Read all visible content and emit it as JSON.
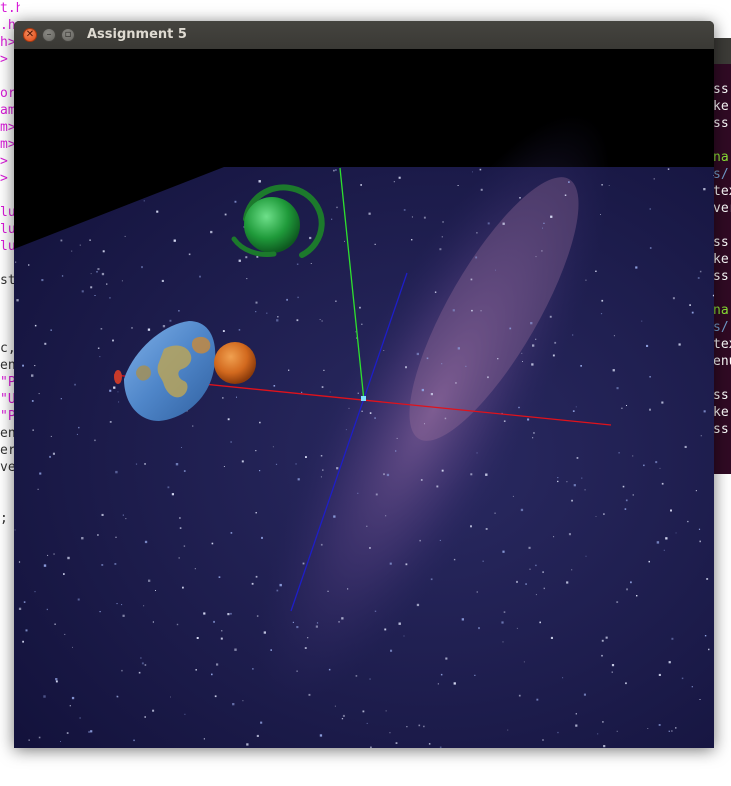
{
  "window": {
    "title": "Assignment 5"
  },
  "background_editor": {
    "lines": [
      {
        "text": "t.h>",
        "color": "#d81bd8"
      },
      {
        "text": ".h",
        "color": "#d81bd8"
      },
      {
        "text": "h>",
        "color": "#d81bd8"
      },
      {
        "text": ">",
        "color": "#d81bd8"
      },
      {
        "text": "",
        "color": "#333333"
      },
      {
        "text": "or",
        "color": "#d81bd8"
      },
      {
        "text": "am",
        "color": "#d81bd8"
      },
      {
        "text": "m>",
        "color": "#d81bd8"
      },
      {
        "text": "m>",
        "color": "#d81bd8"
      },
      {
        "text": ">",
        "color": "#d81bd8"
      },
      {
        "text": ">",
        "color": "#d81bd8"
      },
      {
        "text": "",
        "color": "#333333"
      },
      {
        "text": "lu",
        "color": "#d81bd8"
      },
      {
        "text": "lu",
        "color": "#d81bd8"
      },
      {
        "text": "lu",
        "color": "#d81bd8"
      },
      {
        "text": "",
        "color": "#333333"
      },
      {
        "text": "st",
        "color": "#333333"
      },
      {
        "text": "",
        "color": "#333333"
      },
      {
        "text": "",
        "color": "#333333"
      },
      {
        "text": "",
        "color": "#333333"
      },
      {
        "text": "c,",
        "color": "#333333"
      },
      {
        "text": "en",
        "color": "#333333"
      },
      {
        "text": "\"P",
        "color": "#d81bd8"
      },
      {
        "text": "\"U",
        "color": "#d81bd8"
      },
      {
        "text": "\"P",
        "color": "#d81bd8"
      },
      {
        "text": "en",
        "color": "#333333"
      },
      {
        "text": "er",
        "color": "#333333"
      },
      {
        "text": "ve",
        "color": "#333333"
      },
      {
        "text": "",
        "color": "#333333"
      },
      {
        "text": "",
        "color": "#333333"
      },
      {
        "text": ";",
        "color": "#333333"
      }
    ]
  },
  "background_terminal": {
    "lines": [
      {
        "text": "",
        "color": "#ffffff"
      },
      {
        "text": "ss",
        "color": "#ffffff"
      },
      {
        "text": "ke",
        "color": "#ffffff"
      },
      {
        "text": "ss",
        "color": "#ffffff"
      },
      {
        "text": "",
        "color": "#ffffff"
      },
      {
        "text": "na",
        "color": "#8ae234"
      },
      {
        "text": "s/",
        "color": "#729fcf"
      },
      {
        "text": "tex",
        "color": "#ffffff"
      },
      {
        "text": "ver",
        "color": "#ffffff"
      },
      {
        "text": "",
        "color": "#ffffff"
      },
      {
        "text": "ss",
        "color": "#ffffff"
      },
      {
        "text": "ke",
        "color": "#ffffff"
      },
      {
        "text": "ss",
        "color": "#ffffff"
      },
      {
        "text": "",
        "color": "#ffffff"
      },
      {
        "text": "na",
        "color": "#8ae234"
      },
      {
        "text": "s/",
        "color": "#729fcf"
      },
      {
        "text": "tex",
        "color": "#ffffff"
      },
      {
        "text": "enu",
        "color": "#ffffff"
      },
      {
        "text": "",
        "color": "#ffffff"
      },
      {
        "text": "ss",
        "color": "#ffffff"
      },
      {
        "text": "ke",
        "color": "#ffffff"
      },
      {
        "text": "ss",
        "color": "#ffffff"
      }
    ]
  },
  "scene": {
    "background_color": "#000000",
    "starfield_color": "#1a1748",
    "milky_way_color": "#6a4f8a",
    "axis_colors": {
      "x": "#e0121b",
      "y": "#2ee02e",
      "z": "#1e1ec8"
    },
    "objects": [
      {
        "name": "ringed-planet",
        "kind": "green sphere with ring",
        "color": "#1f9a3a",
        "ring_color": "#1c7a2c"
      },
      {
        "name": "earth-cylinder",
        "kind": "textured world map cylinder",
        "color": "#4f86c9"
      },
      {
        "name": "orange-planet",
        "kind": "orange sphere",
        "color": "#d2691e"
      }
    ]
  }
}
